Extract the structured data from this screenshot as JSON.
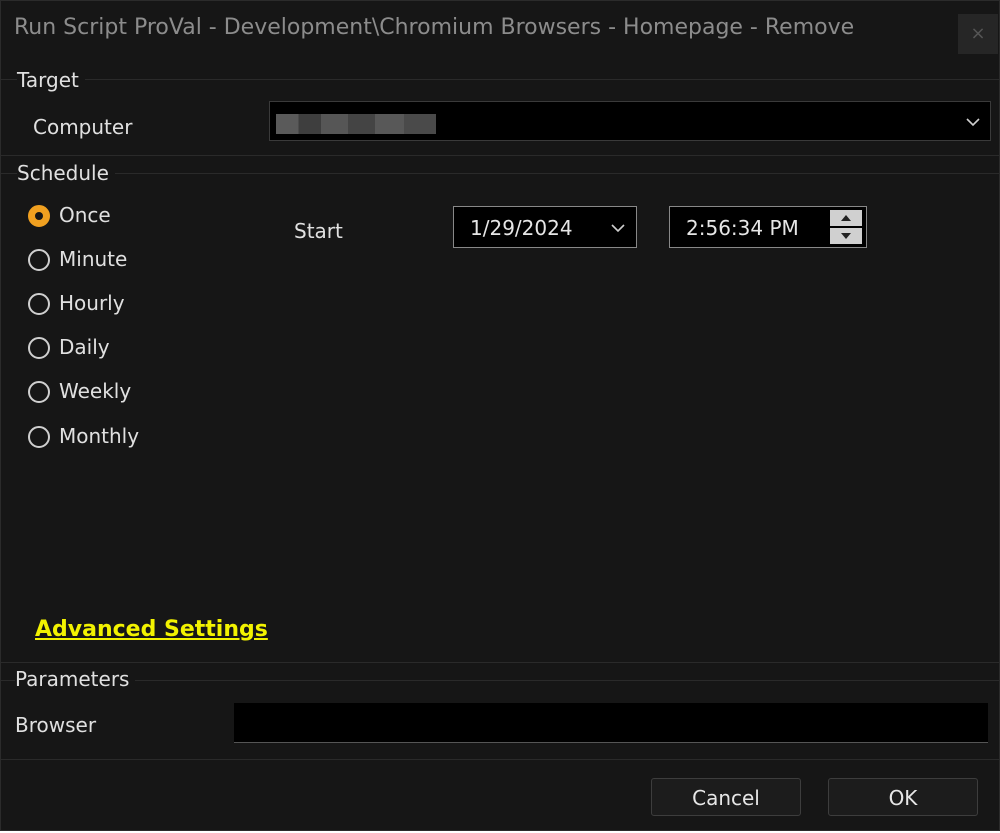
{
  "window": {
    "title": "Run Script ProVal - Development\\Chromium Browsers - Homepage - Remove",
    "close_glyph": "×"
  },
  "target": {
    "section_label": "Target",
    "computer_label": "Computer",
    "computer_value": ""
  },
  "schedule": {
    "section_label": "Schedule",
    "options": [
      {
        "label": "Once",
        "checked": true
      },
      {
        "label": "Minute",
        "checked": false
      },
      {
        "label": "Hourly",
        "checked": false
      },
      {
        "label": "Daily",
        "checked": false
      },
      {
        "label": "Weekly",
        "checked": false
      },
      {
        "label": "Monthly",
        "checked": false
      }
    ],
    "start_label": "Start",
    "start_date": "1/29/2024",
    "start_time": "2:56:34 PM"
  },
  "advanced_settings_label": "Advanced Settings",
  "parameters": {
    "section_label": "Parameters",
    "browser_label": "Browser",
    "browser_value": ""
  },
  "buttons": {
    "cancel": "Cancel",
    "ok": "OK"
  },
  "colors": {
    "background": "#161616",
    "accent_radio": "#f0a020",
    "link": "#f2f200"
  },
  "icons": [
    "close-icon",
    "chevron-down-icon",
    "spin-up-icon",
    "spin-down-icon"
  ]
}
